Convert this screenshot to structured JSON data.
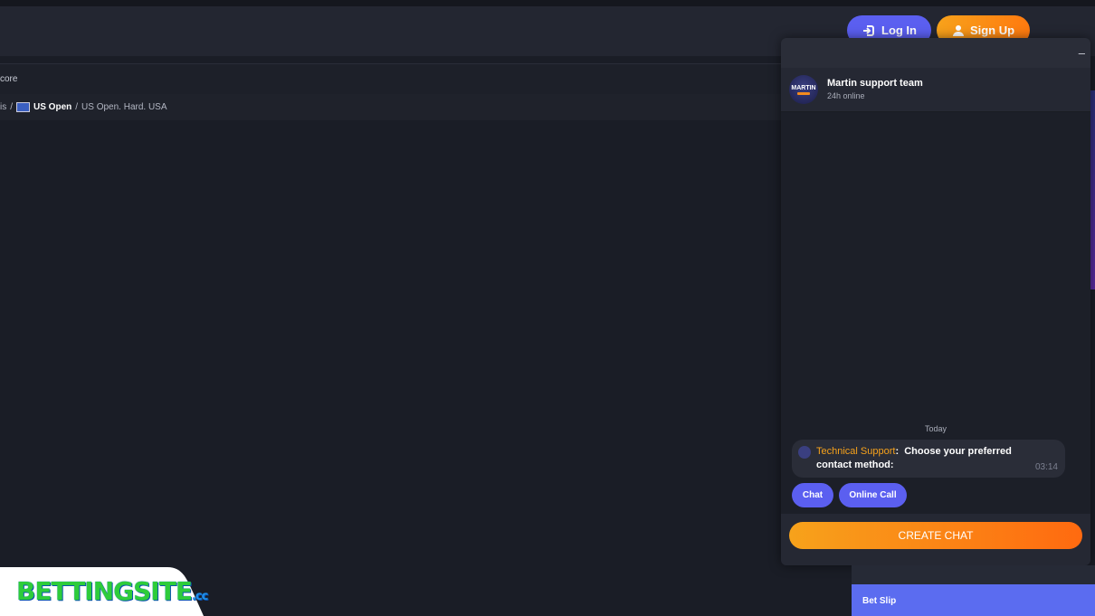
{
  "header": {
    "login_label": "Log In",
    "signup_label": "Sign Up"
  },
  "scorebar": {
    "text": "core"
  },
  "breadcrumb": {
    "item1": "is",
    "sep": "/",
    "item2": "US Open",
    "item3": "US Open. Hard. USA"
  },
  "chat": {
    "minimize": "–",
    "team_name": "Martin support team",
    "team_status": "24h online",
    "avatar_text": "MARTIN",
    "date_label": "Today",
    "message": {
      "sender": "Technical Support",
      "text": "Choose your preferred contact method:",
      "time": "03:14"
    },
    "options": [
      "Chat",
      "Online Call"
    ],
    "create_label": "CREATE CHAT"
  },
  "betslip": {
    "label": "Bet Slip"
  },
  "logo": {
    "text": "BETTINGSITE",
    "suffix": ".cc"
  },
  "colors": {
    "accent": "#5b5ff0",
    "orange": "#f7a21b",
    "background": "#1a1d26"
  }
}
